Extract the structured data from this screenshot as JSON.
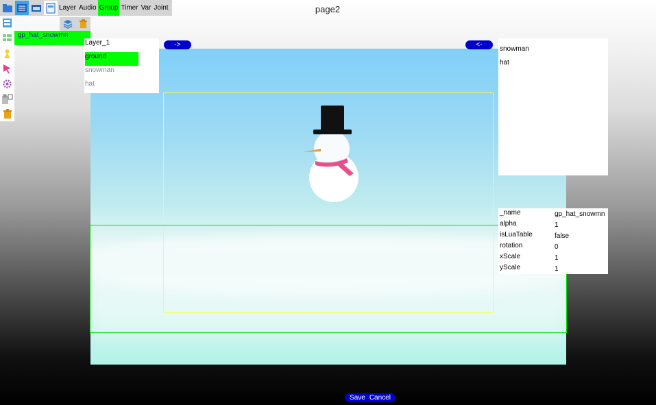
{
  "toolbar": {
    "labels": [
      "Layer",
      "Audio",
      "Group",
      "Timer",
      "Var",
      "Joint"
    ],
    "active": "Group",
    "icons": [
      "folder-icon",
      "list-icon",
      "window-icon",
      "page-icon"
    ]
  },
  "page_title": "page2",
  "top_right_text": "",
  "left_tools": [
    "page-icon",
    "grid-icon",
    "character-icon",
    "pointer-icon",
    "settings-icon",
    "snapshot-icon",
    "trash-icon"
  ],
  "group": {
    "actions": [
      "layers-icon",
      "trash-icon"
    ],
    "selected_name": "gp_hat_snowmn"
  },
  "nav": {
    "forward": "->",
    "back": "<-"
  },
  "layer_panel": {
    "items": [
      {
        "label": "Layer_1",
        "state": "normal"
      },
      {
        "label": "ground",
        "state": "highlighted"
      },
      {
        "label": "snowman",
        "state": "dimmed"
      },
      {
        "label": "hat",
        "state": "dimmed"
      }
    ]
  },
  "group_members": [
    "snowman",
    "hat"
  ],
  "properties": [
    {
      "key": "_name",
      "value": "gp_hat_snowmn"
    },
    {
      "key": "alpha",
      "value": "1"
    },
    {
      "key": "isLuaTable",
      "value": "false"
    },
    {
      "key": "rotation",
      "value": "0"
    },
    {
      "key": "xScale",
      "value": "1"
    },
    {
      "key": "yScale",
      "value": "1"
    }
  ],
  "footer": {
    "save": "Save",
    "cancel": "Cancel"
  },
  "colors": {
    "accent_green": "#00ff00",
    "pill_blue": "#0000cc",
    "toolbar_blue": "#3ba2e8",
    "selection_yellow": "#ffff33"
  }
}
